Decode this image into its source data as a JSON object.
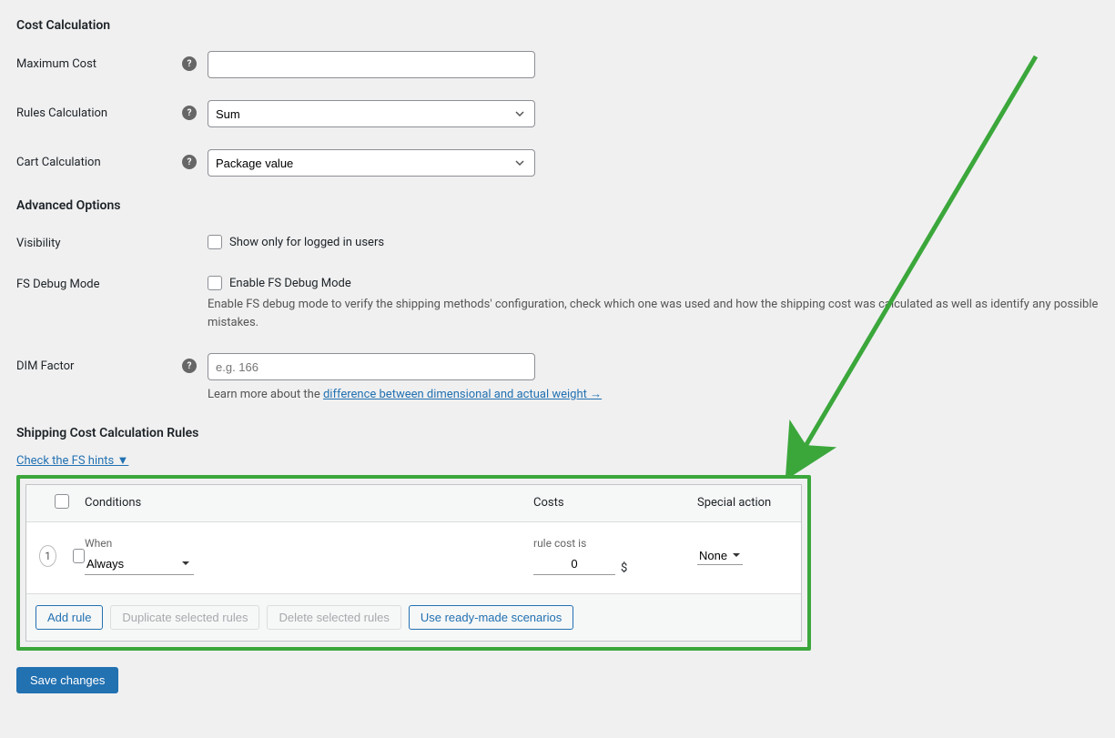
{
  "sections": {
    "cost_calc": "Cost Calculation",
    "advanced": "Advanced Options",
    "rules": "Shipping Cost Calculation Rules"
  },
  "fields": {
    "max_cost": {
      "label": "Maximum Cost",
      "value": ""
    },
    "rules_calc": {
      "label": "Rules Calculation",
      "value": "Sum"
    },
    "cart_calc": {
      "label": "Cart Calculation",
      "value": "Package value"
    },
    "visibility": {
      "label": "Visibility",
      "checkbox_label": "Show only for logged in users"
    },
    "debug": {
      "label": "FS Debug Mode",
      "checkbox_label": "Enable FS Debug Mode",
      "description": "Enable FS debug mode to verify the shipping methods' configuration, check which one was used and how the shipping cost was calculated as well as identify any possible mistakes."
    },
    "dim": {
      "label": "DIM Factor",
      "placeholder": "e.g. 166",
      "help_prefix": "Learn more about the ",
      "help_link": "difference between dimensional and actual weight →"
    }
  },
  "hints_link": "Check the FS hints ▼",
  "rules_table": {
    "headers": {
      "conditions": "Conditions",
      "costs": "Costs",
      "action": "Special action"
    },
    "row": {
      "num": "1",
      "when_label": "When",
      "when_value": "Always",
      "cost_label": "rule cost is",
      "cost_value": "0",
      "currency": "$",
      "action_value": "None"
    },
    "buttons": {
      "add": "Add rule",
      "duplicate": "Duplicate selected rules",
      "delete": "Delete selected rules",
      "scenarios": "Use ready-made scenarios"
    }
  },
  "save": "Save changes"
}
